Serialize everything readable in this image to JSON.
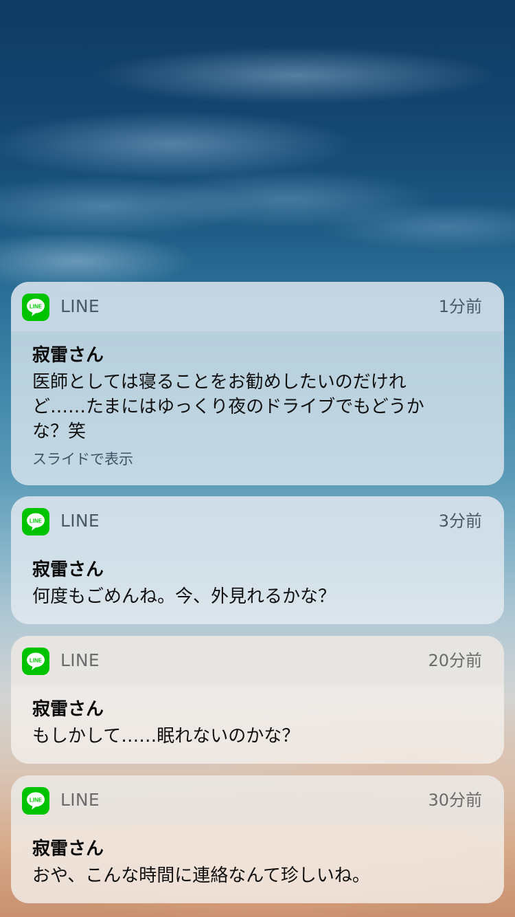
{
  "notifications": [
    {
      "app": "LINE",
      "time": "1分前",
      "sender": "寂雷さん",
      "message": "医師としては寝ることをお勧めしたいのだけれど……たまにはゆっくり夜のドライブでもどうかな？笑",
      "hint": "スライドで表示"
    },
    {
      "app": "LINE",
      "time": "3分前",
      "sender": "寂雷さん",
      "message": "何度もごめんね。今、外見れるかな？"
    },
    {
      "app": "LINE",
      "time": "20分前",
      "sender": "寂雷さん",
      "message": "もしかして……眠れないのかな？"
    },
    {
      "app": "LINE",
      "time": "30分前",
      "sender": "寂雷さん",
      "message": "おや、こんな時間に連絡なんて珍しいね。"
    }
  ],
  "icon": {
    "name": "line-app-icon",
    "label": "LINE",
    "color": "#00c300"
  }
}
